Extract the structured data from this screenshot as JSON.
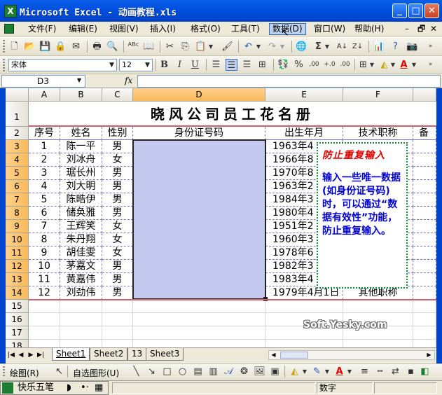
{
  "window": {
    "icon_letter": "X",
    "title": "Microsoft Excel - 动画教程.xls",
    "minimize": "_",
    "maximize": "□",
    "close": "✕"
  },
  "menu": {
    "items": [
      "文件(F)",
      "编辑(E)",
      "视图(V)",
      "插入(I)",
      "格式(O)",
      "工具(T)",
      "数据(D)",
      "窗口(W)",
      "帮助(H)"
    ],
    "active_index": 6,
    "doc_controls": [
      "–",
      "🗗",
      "✕"
    ]
  },
  "format_toolbar": {
    "font": "宋体",
    "size": "12",
    "bold": "B",
    "italic": "I",
    "underline": "U",
    "percent": "%",
    "decimals": ",00"
  },
  "formula_bar": {
    "name_box": "D3",
    "fx": "fx",
    "formula": ""
  },
  "grid": {
    "columns": [
      "A",
      "B",
      "C",
      "D",
      "E",
      "F"
    ],
    "selected_column": "D",
    "title": "晓风公司员工花名册",
    "headers": [
      "序号",
      "姓名",
      "性别",
      "身份证号码",
      "出生年月",
      "技术职称",
      "备"
    ],
    "rows": [
      {
        "no": "1",
        "name": "陈一平",
        "sex": "男",
        "birth": "1963年4"
      },
      {
        "no": "2",
        "name": "刘冰舟",
        "sex": "女",
        "birth": "1966年8"
      },
      {
        "no": "3",
        "name": "琚长州",
        "sex": "男",
        "birth": "1970年8"
      },
      {
        "no": "4",
        "name": "刘大明",
        "sex": "男",
        "birth": "1963年2"
      },
      {
        "no": "5",
        "name": "陈晧伊",
        "sex": "男",
        "birth": "1984年3"
      },
      {
        "no": "6",
        "name": "储奂雅",
        "sex": "男",
        "birth": "1980年4"
      },
      {
        "no": "7",
        "name": "王辉笑",
        "sex": "女",
        "birth": "1951年2"
      },
      {
        "no": "8",
        "name": "朱丹翔",
        "sex": "女",
        "birth": "1960年3"
      },
      {
        "no": "9",
        "name": "胡佳雯",
        "sex": "女",
        "birth": "1978年6"
      },
      {
        "no": "10",
        "name": "茅嘉文",
        "sex": "男",
        "birth": "1982年3"
      },
      {
        "no": "11",
        "name": "黄嘉伟",
        "sex": "男",
        "birth": "1983年4"
      },
      {
        "no": "12",
        "name": "刘劲伟",
        "sex": "男",
        "birth": "1979年4月1日",
        "title": "其他职称"
      }
    ],
    "row_numbers": [
      "1",
      "2",
      "3",
      "4",
      "5",
      "6",
      "7",
      "8",
      "9",
      "10",
      "11",
      "12",
      "13",
      "14",
      "15",
      "16",
      "17",
      "18"
    ],
    "selected_rows": [
      "3",
      "4",
      "5",
      "6",
      "7",
      "8",
      "9",
      "10",
      "11",
      "12",
      "13",
      "14"
    ]
  },
  "comment": {
    "title": "防止重复输入",
    "body": "输入一些唯一数据(如身份证号码)时，可以通过“数据有效性”功能，防止重复输入。"
  },
  "watermark": "Soft.Yesky.com",
  "sheet_tabs": {
    "nav": [
      "|◀",
      "◀",
      "▶",
      "▶|"
    ],
    "tabs": [
      "Sheet1",
      "Sheet2",
      "13",
      "Sheet3"
    ],
    "active_index": 0
  },
  "draw_toolbar": {
    "draw_label": "绘图(R)",
    "autoshape_label": "自选图形(U)"
  },
  "status": {
    "ime_label": "快乐五笔",
    "mode": "数字"
  },
  "colors": {
    "title_bar": "#0051e0",
    "selection_fill": "#c6c9ef",
    "comment_title": "#e00000",
    "comment_body": "#0000d0",
    "comment_border": "#1a8a3a"
  }
}
